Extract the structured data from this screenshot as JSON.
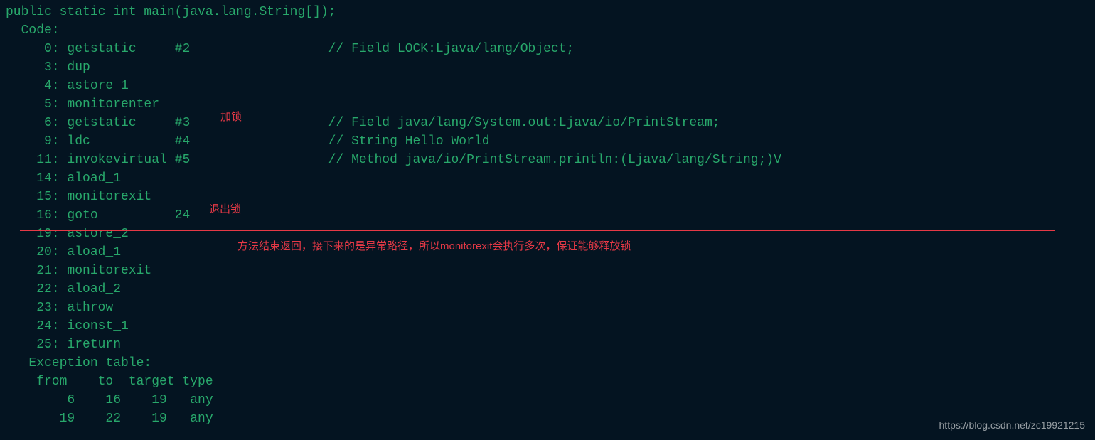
{
  "signature": "public static int main(java.lang.String[]);",
  "code_label": "  Code:",
  "instr": [
    "     0: getstatic     #2                  // Field LOCK:Ljava/lang/Object;",
    "     3: dup",
    "     4: astore_1",
    "     5: monitorenter",
    "     6: getstatic     #3                  // Field java/lang/System.out:Ljava/io/PrintStream;",
    "     9: ldc           #4                  // String Hello World",
    "    11: invokevirtual #5                  // Method java/io/PrintStream.println:(Ljava/lang/String;)V",
    "    14: aload_1",
    "    15: monitorexit",
    "    16: goto          24",
    "    19: astore_2",
    "    20: aload_1",
    "    21: monitorexit",
    "    22: aload_2",
    "    23: athrow",
    "    24: iconst_1",
    "    25: ireturn"
  ],
  "exc_header": "   Exception table:",
  "exc_cols": "    from    to  target type",
  "exc_rows": [
    "        6    16    19   any",
    "       19    22    19   any"
  ],
  "annotations": {
    "lock": "加锁",
    "unlock": "退出锁",
    "note": "方法结束返回，接下来的是异常路径，所以monitorexit会执行多次，保证能够释放锁"
  },
  "watermark": "https://blog.csdn.net/zc19921215"
}
